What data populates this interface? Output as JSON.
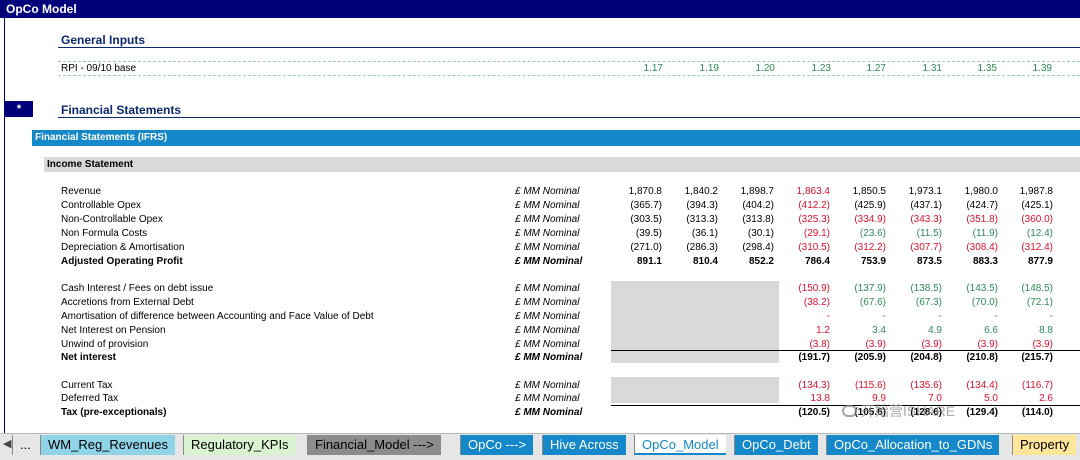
{
  "sheet_title": "OpCo Model",
  "general_inputs": {
    "title": "General Inputs",
    "rpi_label": "RPI - 09/10 base",
    "rpi_values": [
      "1.17",
      "1.19",
      "1.20",
      "1.23",
      "1.27",
      "1.31",
      "1.35",
      "1.39"
    ]
  },
  "financial_statements": {
    "marker": "*",
    "title": "Financial Statements",
    "ifrs_header": "Financial Statements (IFRS)",
    "income_statement_header": "Income Statement"
  },
  "rows": [
    {
      "label": "Revenue",
      "unit": "£ MM Nominal",
      "bold": false,
      "values": [
        "1,870.8",
        "1,840.2",
        "1,898.7",
        "1,863.4",
        "1,850.5",
        "1,973.1",
        "1,980.0",
        "1,987.8"
      ],
      "colors": [
        "black",
        "black",
        "black",
        "red",
        "black",
        "black",
        "black",
        "black"
      ]
    },
    {
      "label": "Controllable Opex",
      "unit": "£ MM Nominal",
      "bold": false,
      "values": [
        "(365.7)",
        "(394.3)",
        "(404.2)",
        "(412.2)",
        "(425.9)",
        "(437.1)",
        "(424.7)",
        "(425.1)"
      ],
      "colors": [
        "black",
        "black",
        "black",
        "red",
        "black",
        "black",
        "black",
        "black"
      ]
    },
    {
      "label": "Non-Controllable Opex",
      "unit": "£ MM Nominal",
      "bold": false,
      "values": [
        "(303.5)",
        "(313.3)",
        "(313.8)",
        "(325.3)",
        "(334.9)",
        "(343.3)",
        "(351.8)",
        "(360.0)"
      ],
      "colors": [
        "black",
        "black",
        "black",
        "red",
        "red",
        "red",
        "red",
        "red"
      ]
    },
    {
      "label": "Non Formula Costs",
      "unit": "£ MM Nominal",
      "bold": false,
      "values": [
        "(39.5)",
        "(36.1)",
        "(30.1)",
        "(29.1)",
        "(23.6)",
        "(11.5)",
        "(11.9)",
        "(12.4)"
      ],
      "colors": [
        "black",
        "black",
        "black",
        "red",
        "green",
        "green",
        "green",
        "green"
      ]
    },
    {
      "label": "Depreciation & Amortisation",
      "unit": "£ MM Nominal",
      "bold": false,
      "values": [
        "(271.0)",
        "(286.3)",
        "(298.4)",
        "(310.5)",
        "(312.2)",
        "(307.7)",
        "(308.4)",
        "(312.4)"
      ],
      "colors": [
        "black",
        "black",
        "black",
        "red",
        "red",
        "red",
        "red",
        "red"
      ]
    },
    {
      "label": "Adjusted Operating Profit",
      "unit": "£ MM Nominal",
      "bold": true,
      "values": [
        "891.1",
        "810.4",
        "852.2",
        "786.4",
        "753.9",
        "873.5",
        "883.3",
        "877.9"
      ],
      "colors": [
        "black",
        "black",
        "black",
        "black",
        "black",
        "black",
        "black",
        "black"
      ]
    },
    {
      "label": "Cash Interest / Fees on debt issue",
      "unit": "£ MM Nominal",
      "bold": false,
      "values": [
        "",
        "",
        "",
        "(150.9)",
        "(137.9)",
        "(138.5)",
        "(143.5)",
        "(148.5)"
      ],
      "colors": [
        "black",
        "black",
        "black",
        "red",
        "green",
        "green",
        "green",
        "green"
      ]
    },
    {
      "label": "Accretions from External Debt",
      "unit": "£ MM Nominal",
      "bold": false,
      "values": [
        "",
        "",
        "",
        "(38.2)",
        "(67.6)",
        "(67.3)",
        "(70.0)",
        "(72.1)"
      ],
      "colors": [
        "black",
        "black",
        "black",
        "red",
        "green",
        "green",
        "green",
        "green"
      ]
    },
    {
      "label": "Amortisation of difference between Accounting and Face Value of Debt",
      "unit": "£ MM Nominal",
      "bold": false,
      "values": [
        "",
        "",
        "",
        "-",
        "-",
        "-",
        "-",
        "-"
      ],
      "colors": [
        "black",
        "black",
        "black",
        "red",
        "green",
        "green",
        "green",
        "green"
      ]
    },
    {
      "label": "Net Interest on Pension",
      "unit": "£ MM Nominal",
      "bold": false,
      "values": [
        "",
        "",
        "",
        "1.2",
        "3.4",
        "4.9",
        "6.6",
        "8.8"
      ],
      "colors": [
        "black",
        "black",
        "black",
        "red",
        "green",
        "green",
        "green",
        "green"
      ]
    },
    {
      "label": "Unwind of provision",
      "unit": "£ MM Nominal",
      "bold": false,
      "values": [
        "",
        "",
        "",
        "(3.8)",
        "(3.9)",
        "(3.9)",
        "(3.9)",
        "(3.9)"
      ],
      "colors": [
        "black",
        "black",
        "black",
        "red",
        "red",
        "red",
        "red",
        "red"
      ]
    },
    {
      "label": "Net interest",
      "unit": "£ MM Nominal",
      "bold": true,
      "values": [
        "",
        "",
        "",
        "(191.7)",
        "(205.9)",
        "(204.8)",
        "(210.8)",
        "(215.7)"
      ],
      "colors": [
        "black",
        "black",
        "black",
        "black",
        "black",
        "black",
        "black",
        "black"
      ]
    },
    {
      "label": "Current Tax",
      "unit": "£ MM Nominal",
      "bold": false,
      "values": [
        "",
        "",
        "",
        "(134.3)",
        "(115.6)",
        "(135.6)",
        "(134.4)",
        "(116.7)"
      ],
      "colors": [
        "black",
        "black",
        "black",
        "red",
        "red",
        "red",
        "red",
        "red"
      ]
    },
    {
      "label": "Deferred Tax",
      "unit": "£ MM Nominal",
      "bold": false,
      "values": [
        "",
        "",
        "",
        "13.8",
        "9.9",
        "7.0",
        "5.0",
        "2.6"
      ],
      "colors": [
        "black",
        "black",
        "black",
        "red",
        "red",
        "red",
        "red",
        "red"
      ]
    },
    {
      "label": "Tax (pre-exceptionals)",
      "unit": "£ MM Nominal",
      "bold": true,
      "values": [
        "",
        "",
        "",
        "(120.5)",
        "(105.6)",
        "(128.6)",
        "(129.4)",
        "(114.0)"
      ],
      "colors": [
        "black",
        "black",
        "black",
        "black",
        "black",
        "black",
        "black",
        "black"
      ]
    }
  ],
  "sheet_tabs": [
    {
      "label": "...",
      "color": "#e6e6e6",
      "text_color": "#000000"
    },
    {
      "label": "WM_Reg_Revenues",
      "color": "#8fd4e6",
      "text_color": "#000000"
    },
    {
      "label": "Regulatory_KPIs",
      "color": "#d9f2d0",
      "text_color": "#000000"
    },
    {
      "label": "Financial_Model --->",
      "color": "#8c8c8c",
      "text_color": "#000000"
    },
    {
      "label": "OpCo --->",
      "color": "#1488c8",
      "text_color": "#ffffff"
    },
    {
      "label": "Hive Across",
      "color": "#1488c8",
      "text_color": "#ffffff"
    },
    {
      "label": "OpCo_Model",
      "color": "#ffffff",
      "text_color": "#1488c8"
    },
    {
      "label": "OpCo_Debt",
      "color": "#1488c8",
      "text_color": "#ffffff"
    },
    {
      "label": "OpCo_Allocation_to_GDNs",
      "color": "#1488c8",
      "text_color": "#ffffff"
    },
    {
      "label": "Property",
      "color": "#ffe699",
      "text_color": "#000000"
    }
  ],
  "watermark": "开始营ISHARE",
  "colors": {
    "red": "#e0102b",
    "green": "#2e8b57",
    "header_navy": "#00007a",
    "ifrs_blue": "#1488c8"
  }
}
